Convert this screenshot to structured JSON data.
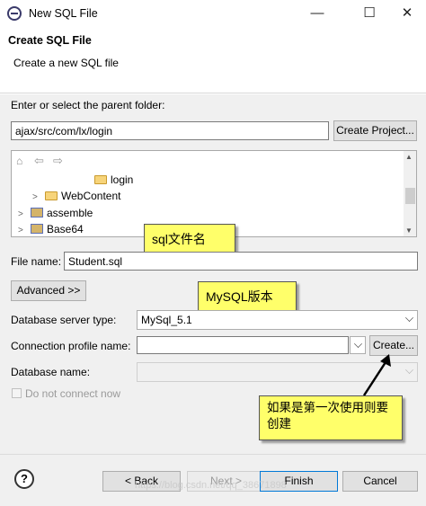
{
  "window": {
    "title": "New SQL File",
    "minimize": "—",
    "maximize": "☐",
    "close": "✕"
  },
  "header": {
    "title": "Create SQL File",
    "description": "Create a new SQL file"
  },
  "parent_folder": {
    "label": "Enter or select the parent folder:",
    "value": "ajax/src/com/lx/login",
    "create_project_button": "Create Project..."
  },
  "tree": {
    "items": [
      {
        "label": "login",
        "kind": "folder"
      },
      {
        "label": "WebContent",
        "kind": "folder"
      },
      {
        "label": "assemble",
        "kind": "project"
      },
      {
        "label": "Base64",
        "kind": "project"
      }
    ]
  },
  "file_name": {
    "label": "File name:",
    "value": "Student.sql"
  },
  "advanced_button": "Advanced >>",
  "db_server_type": {
    "label": "Database server type:",
    "value": "MySql_5.1"
  },
  "connection_profile": {
    "label": "Connection profile name:",
    "value": "",
    "create_button": "Create..."
  },
  "database_name": {
    "label": "Database name:",
    "value": ""
  },
  "no_connect": {
    "label": "Do not connect now",
    "checked": false
  },
  "callouts": {
    "filename": "sql文件名",
    "mysql": "MySQL版本",
    "create": "如果是第一次使用则要创建"
  },
  "footer": {
    "help": "?",
    "back": "< Back",
    "next": "Next >",
    "finish": "Finish",
    "cancel": "Cancel"
  },
  "watermark": "https://blog.csdn.net/qq_38671898",
  "colors": {
    "callout_bg": "#ffff6a",
    "arrow": "#000000"
  }
}
